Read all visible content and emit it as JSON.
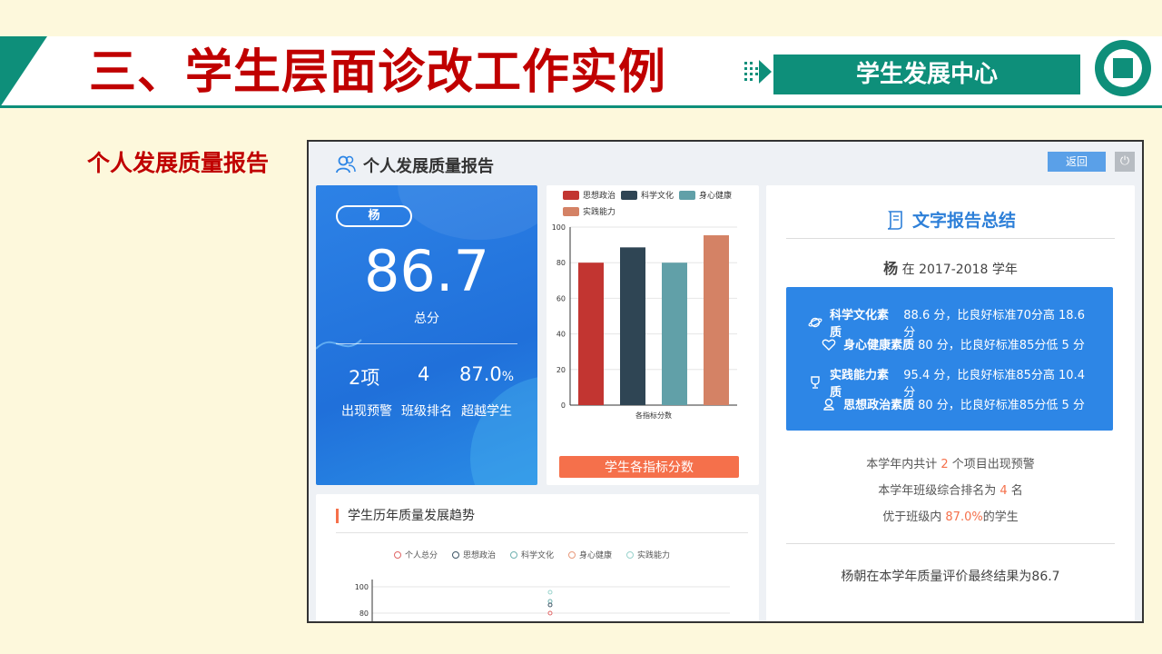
{
  "slide": {
    "title": "三、学生层面诊改工作实例",
    "center_label": "学生发展中心",
    "side_label": "个人发展质量报告"
  },
  "app": {
    "header_title": "个人发展质量报告",
    "back_label": "返回",
    "power_glyph": "⏻",
    "score_card": {
      "student_name": "杨",
      "total_score": "86.7",
      "total_caption": "总分",
      "stats": [
        {
          "value": "2项",
          "label": "出现预警"
        },
        {
          "value": "4",
          "label": "班级排名"
        },
        {
          "value": "87.0",
          "unit": "%",
          "label": "超越学生"
        }
      ]
    },
    "bar_chart_button": "学生各指标分数",
    "report": {
      "title": "文字报告总结",
      "student_name": "杨",
      "year_text": "在 2017-2018 学年",
      "items": [
        {
          "icon": "planet-icon",
          "name": "科学文化素质",
          "text": "88.6 分，比良好标准70分高 18.6 分"
        },
        {
          "icon": "heart-icon",
          "name": "身心健康素质",
          "text": "80 分，比良好标准85分低 5 分"
        },
        {
          "icon": "trophy-icon",
          "name": "实践能力素质",
          "text": "95.4 分，比良好标准85分高 10.4 分"
        },
        {
          "icon": "medal-icon",
          "name": "思想政治素质",
          "text": "80 分，比良好标准85分低 5 分"
        }
      ],
      "warn_pre": "本学年内共计 ",
      "warn_num": "2",
      "warn_post": " 个项目出现预警",
      "rank_pre": "本学年班级综合排名为 ",
      "rank_num": "4",
      "rank_post": " 名",
      "exceed_pre": "优于班级内 ",
      "exceed_num": "87.0%",
      "exceed_post": "的学生",
      "final": "杨朝在本学年质量评价最终结果为86.7"
    },
    "trend": {
      "title": "学生历年质量发展趋势"
    }
  },
  "colors": {
    "brand_green": "#0e8f7a",
    "title_red": "#c00000",
    "accent_blue": "#2d86e6",
    "accent_orange": "#f5704b"
  },
  "chart_data": [
    {
      "type": "bar",
      "categories": [
        "思想政治",
        "科学文化",
        "身心健康",
        "实践能力"
      ],
      "series": [
        {
          "name": "思想政治",
          "color": "#c23531",
          "values": [
            80
          ]
        },
        {
          "name": "科学文化",
          "color": "#2f4554",
          "values": [
            88.6
          ]
        },
        {
          "name": "身心健康",
          "color": "#61a0a8",
          "values": [
            80
          ]
        },
        {
          "name": "实践能力",
          "color": "#d48265",
          "values": [
            95.4
          ]
        }
      ],
      "xlabel": "各指标分数",
      "ylim": [
        0,
        100
      ],
      "yticks": [
        0,
        20,
        40,
        60,
        80,
        100
      ]
    },
    {
      "type": "line",
      "title": "学生历年质量发展趋势",
      "series": [
        {
          "name": "个人总分",
          "color": "#e06666"
        },
        {
          "name": "思想政治",
          "color": "#3d5566"
        },
        {
          "name": "科学文化",
          "color": "#6fb1b0"
        },
        {
          "name": "身心健康",
          "color": "#e89a7c"
        },
        {
          "name": "实践能力",
          "color": "#99d3cc"
        }
      ],
      "visible_yticks": [
        100,
        80
      ]
    }
  ]
}
